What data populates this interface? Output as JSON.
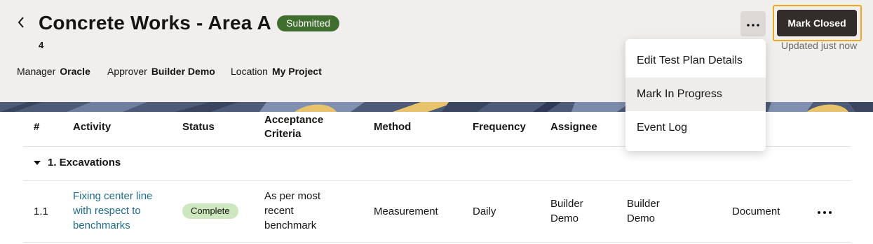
{
  "header": {
    "title": "Concrete Works - Area A",
    "status": "Submitted",
    "number": "4",
    "meta": [
      {
        "label": "Manager",
        "value": "Oracle"
      },
      {
        "label": "Approver",
        "value": "Builder Demo"
      },
      {
        "label": "Location",
        "value": "My Project"
      }
    ],
    "primary_action": "Mark Closed",
    "updated_text": "Updated just now",
    "more_icon": "ellipsis-icon",
    "back_icon": "chevron-left-icon"
  },
  "menu": {
    "items": [
      {
        "label": "Edit Test Plan Details"
      },
      {
        "label": "Mark In Progress"
      },
      {
        "label": "Event Log"
      }
    ],
    "hovered_index": 1
  },
  "table": {
    "columns": [
      "#",
      "Activity",
      "Status",
      "Acceptance Criteria",
      "Method",
      "Frequency",
      "Assignee"
    ],
    "groups": [
      {
        "label": "1. Excavations",
        "rows": [
          {
            "num": "1.1",
            "activity": [
              "Fixing center line",
              "with respect to",
              "benchmarks"
            ],
            "status": "Complete",
            "criteria": [
              "As per most",
              "recent",
              "benchmark"
            ],
            "method": "Measurement",
            "frequency": "Daily",
            "assignee": [
              "Builder",
              "Demo"
            ],
            "col8": [
              "Builder",
              "Demo"
            ],
            "col9": "Document"
          }
        ]
      }
    ]
  },
  "colors": {
    "header_bg": "#f1efed",
    "status_badge": "#3f6e2f",
    "primary_button": "#322d28",
    "focus_ring": "#f0a81e",
    "complete_chip": "#cde8be",
    "link": "#1f6b8e"
  }
}
